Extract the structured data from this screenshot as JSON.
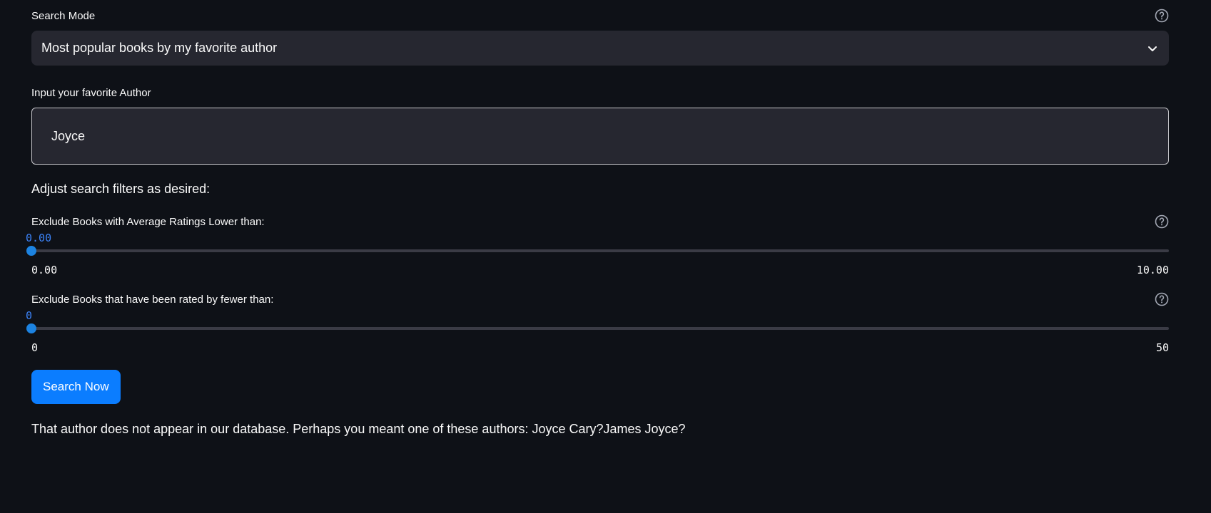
{
  "search_mode": {
    "label": "Search Mode",
    "selected": "Most popular books by my favorite author"
  },
  "author_input": {
    "label": "Input your favorite Author",
    "value": "Joyce"
  },
  "filters": {
    "heading": "Adjust search filters as desired:",
    "rating_slider": {
      "label": "Exclude Books with Average Ratings Lower than:",
      "value_text": "0.00",
      "min_text": "0.00",
      "max_text": "10.00",
      "value": 0,
      "min": 0,
      "max": 10
    },
    "count_slider": {
      "label": "Exclude Books that have been rated by fewer than:",
      "value_text": "0",
      "min_text": "0",
      "max_text": "50",
      "value": 0,
      "min": 0,
      "max": 50
    }
  },
  "search_button": {
    "label": "Search Now"
  },
  "result_message": "That author does not appear in our database. Perhaps you meant one of these authors: Joyce Cary?James Joyce?",
  "colors": {
    "background": "#0e1117",
    "widget_bg": "#262730",
    "accent": "#0b7dff",
    "slider_accent": "#1c83e1"
  },
  "icons": {
    "help": "help-circle-icon",
    "dropdown": "chevron-down-icon"
  }
}
